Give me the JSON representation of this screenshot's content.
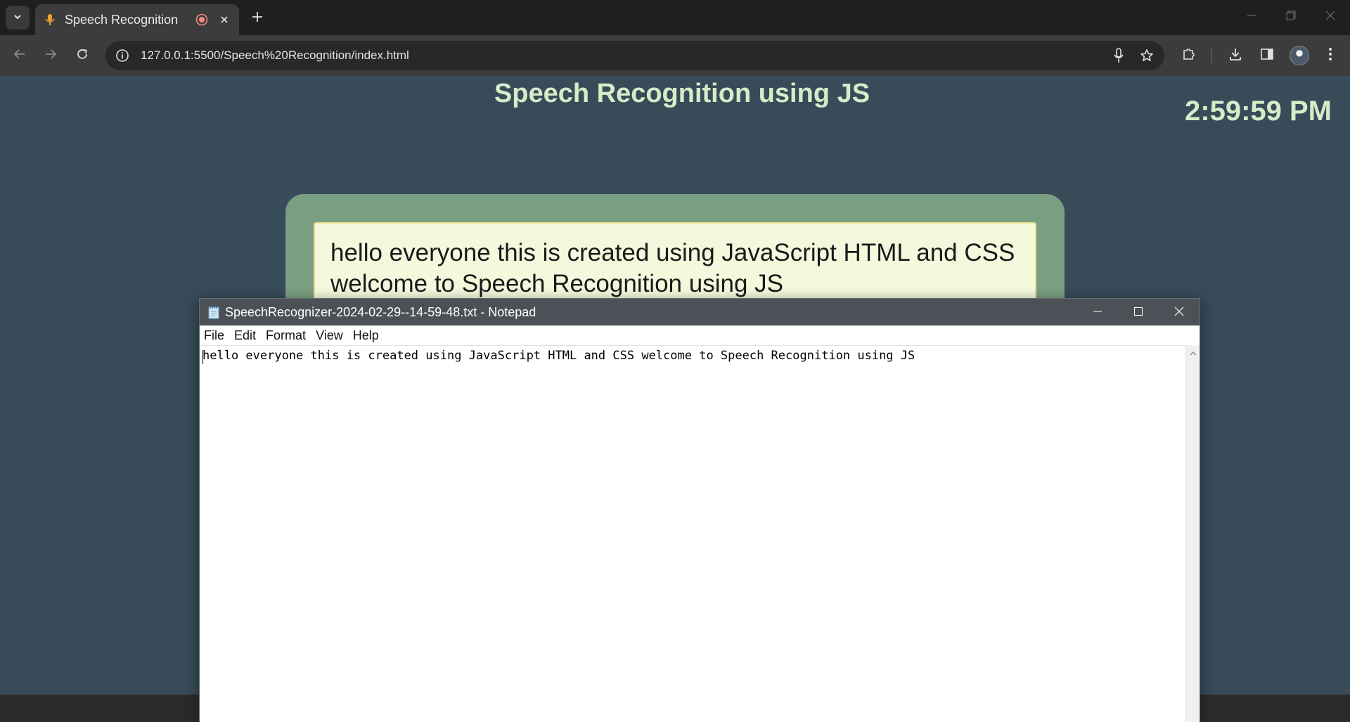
{
  "browser": {
    "tab_title": "Speech Recognition",
    "url": "127.0.0.1:5500/Speech%20Recognition/index.html"
  },
  "page": {
    "title": "Speech Recognition using JS",
    "clock": "2:59:59 PM",
    "transcript": "hello everyone this is created using JavaScript HTML and CSS welcome to Speech Recognition using JS"
  },
  "notepad": {
    "title": "SpeechRecognizer-2024-02-29--14-59-48.txt - Notepad",
    "menu": [
      "File",
      "Edit",
      "Format",
      "View",
      "Help"
    ],
    "content": "hello everyone this is created using JavaScript HTML and CSS welcome to Speech Recognition using JS"
  }
}
